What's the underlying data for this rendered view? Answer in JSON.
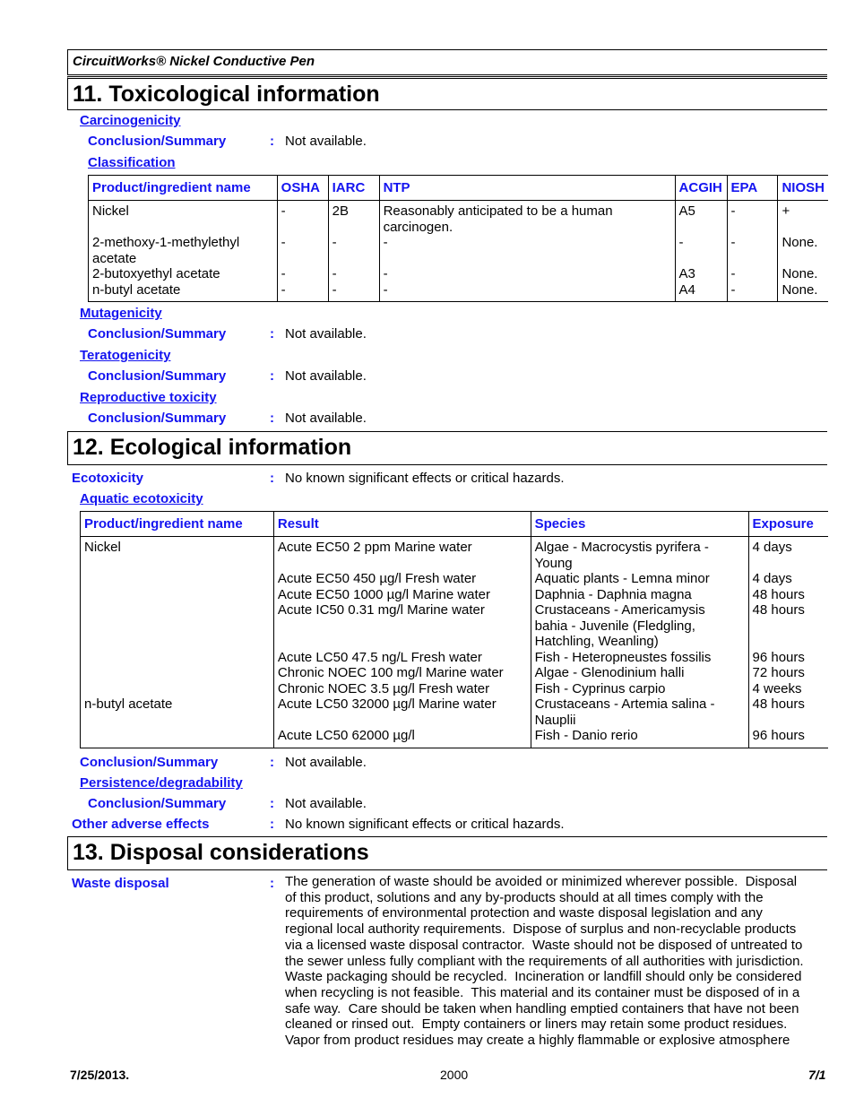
{
  "product_name": "CircuitWorks® Nickel Conductive Pen",
  "section11": {
    "title": "11. Toxicological information",
    "carcinogenicity": {
      "heading": "Carcinogenicity",
      "conclusion_label": "Conclusion/Summary",
      "conclusion_value": "Not available.",
      "classification_heading": "Classification",
      "table": {
        "headers": [
          "Product/ingredient name",
          "OSHA",
          "IARC",
          "NTP",
          "ACGIH",
          "EPA",
          "NIOSH"
        ],
        "rows": [
          {
            "name": "Nickel",
            "osha": "-",
            "iarc": "2B",
            "ntp": "Reasonably anticipated to be a human carcinogen.",
            "acgih": "A5",
            "epa": "-",
            "niosh": "+"
          },
          {
            "name": "2-methoxy-1-methylethyl acetate",
            "osha": "-",
            "iarc": "-",
            "ntp": "-",
            "acgih": "-",
            "epa": "-",
            "niosh": "None."
          },
          {
            "name": "2-butoxyethyl acetate",
            "osha": "-",
            "iarc": "-",
            "ntp": "-",
            "acgih": "A3",
            "epa": "-",
            "niosh": "None."
          },
          {
            "name": "n-butyl acetate",
            "osha": "-",
            "iarc": "-",
            "ntp": "-",
            "acgih": "A4",
            "epa": "-",
            "niosh": "None."
          }
        ]
      }
    },
    "mutagenicity": {
      "heading": "Mutagenicity",
      "conclusion_label": "Conclusion/Summary",
      "conclusion_value": "Not available."
    },
    "teratogenicity": {
      "heading": "Teratogenicity",
      "conclusion_label": "Conclusion/Summary",
      "conclusion_value": "Not available."
    },
    "reproductive": {
      "heading": "Reproductive toxicity",
      "conclusion_label": "Conclusion/Summary",
      "conclusion_value": "Not available."
    }
  },
  "section12": {
    "title": "12. Ecological information",
    "ecotoxicity_label": "Ecotoxicity",
    "ecotoxicity_value": "No known significant effects or critical hazards.",
    "aquatic_heading": "Aquatic ecotoxicity",
    "table": {
      "headers": [
        "Product/ingredient name",
        "Result",
        "Species",
        "Exposure"
      ],
      "rows": [
        {
          "name": "Nickel",
          "result": "Acute EC50 2 ppm Marine water",
          "species": "Algae - Macrocystis pyrifera - Young",
          "exposure": "4 days"
        },
        {
          "name": "",
          "result": "Acute EC50 450 µg/l Fresh water",
          "species": "Aquatic plants - Lemna minor",
          "exposure": "4 days"
        },
        {
          "name": "",
          "result": "Acute EC50 1000 µg/l Marine water",
          "species": "Daphnia - Daphnia magna",
          "exposure": "48 hours"
        },
        {
          "name": "",
          "result": "Acute IC50 0.31 mg/l Marine water",
          "species": "Crustaceans - Americamysis bahia - Juvenile (Fledgling, Hatchling, Weanling)",
          "exposure": "48 hours"
        },
        {
          "name": "",
          "result": "Acute LC50 47.5 ng/L Fresh water",
          "species": "Fish - Heteropneustes fossilis",
          "exposure": "96 hours"
        },
        {
          "name": "",
          "result": "Chronic NOEC 100 mg/l Marine water",
          "species": "Algae - Glenodinium halli",
          "exposure": "72 hours"
        },
        {
          "name": "",
          "result": "Chronic NOEC 3.5 µg/l Fresh water",
          "species": "Fish - Cyprinus carpio",
          "exposure": "4 weeks"
        },
        {
          "name": "n-butyl acetate",
          "result": "Acute LC50 32000 µg/l Marine water",
          "species": "Crustaceans - Artemia salina - Nauplii",
          "exposure": "48 hours"
        },
        {
          "name": "",
          "result": "Acute LC50 62000 µg/l",
          "species": "Fish - Danio rerio",
          "exposure": "96 hours"
        }
      ]
    },
    "aquatic_conclusion_label": "Conclusion/Summary",
    "aquatic_conclusion_value": "Not available.",
    "persistence_heading": "Persistence/degradability",
    "persistence_conclusion_label": "Conclusion/Summary",
    "persistence_conclusion_value": "Not available.",
    "other_label": "Other adverse effects",
    "other_value": "No known significant effects or critical hazards."
  },
  "section13": {
    "title": "13. Disposal considerations",
    "waste_label": "Waste disposal",
    "waste_lines": [
      "The generation of waste should be avoided or minimized wherever possible.  Disposal",
      "of this product, solutions and any by-products should at all times comply with the",
      "requirements of environmental protection and waste disposal legislation and any",
      "regional local authority requirements.  Dispose of surplus and non-recyclable products",
      "via a licensed waste disposal contractor.  Waste should not be disposed of untreated to",
      "the sewer unless fully compliant with the requirements of all authorities with jurisdiction.",
      "Waste packaging should be recycled.  Incineration or landfill should only be considered",
      "when recycling is not feasible.  This material and its container must be disposed of in a",
      "safe way.  Care should be taken when handling emptied containers that have not been",
      "cleaned or rinsed out.  Empty containers or liners may retain some product residues.",
      "Vapor from product residues may create a highly flammable or explosive atmosphere"
    ]
  },
  "footer": {
    "date": "7/25/2013.",
    "code": "2000",
    "page": "7/1"
  }
}
